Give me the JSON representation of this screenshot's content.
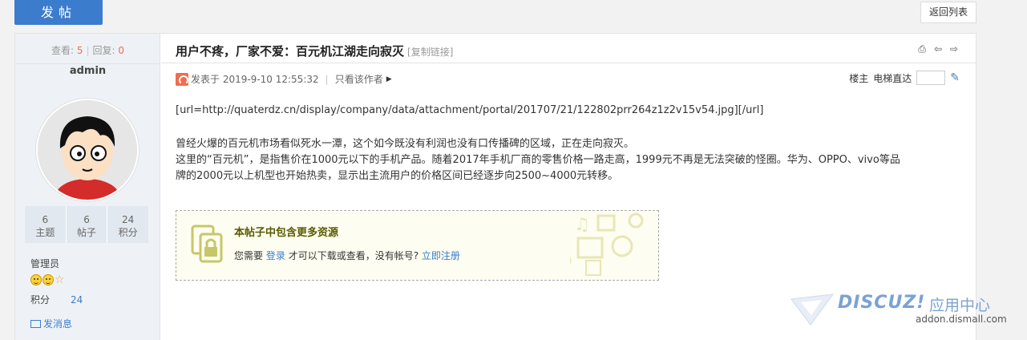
{
  "toolbar": {
    "post_label": "发帖",
    "back_label": "返回列表"
  },
  "sidebar": {
    "views_label": "查看:",
    "views": "5",
    "replies_label": "回复:",
    "replies": "0",
    "author": "admin",
    "stats": [
      {
        "value": "6",
        "label": "主题"
      },
      {
        "value": "6",
        "label": "帖子"
      },
      {
        "value": "24",
        "label": "积分"
      }
    ],
    "role": "管理员",
    "points_label": "积分",
    "points_value": "24",
    "message_label": "发消息"
  },
  "post": {
    "title": "用户不疼，厂家不爱：百元机江湖走向寂灭",
    "copy_link": "[复制链接]",
    "posted_label": "发表于 2019-9-10 12:55:32",
    "author_only": "只看该作者",
    "floor_owner": "楼主",
    "jump_label": "电梯直达",
    "body": {
      "url_line": "[url=http://quaterdz.cn/display/company/data/attachment/portal/201707/21/122802prr264z1z2v15v54.jpg][/url]",
      "p1": "曾经火爆的百元机市场看似死水一潭，这个如今既没有利润也没有口传播碑的区域，正在走向寂灭。",
      "p2": "这里的“百元机”，是指售价在1000元以下的手机产品。随着2017年手机厂商的零售价格一路走高，1999元不再是无法突破的怪圈。华为、OPPO、vivo等品",
      "p3": "牌的2000元以上机型也开始热卖，显示出主流用户的价格区间已经逐步向2500~4000元转移。"
    },
    "locked": {
      "title": "本帖子中包含更多资源",
      "desc_prefix": "您需要",
      "login": "登录",
      "desc_mid": "才可以下载或查看，没有帐号?",
      "register": "立即注册"
    }
  },
  "watermark": {
    "brand": "DISCUZ!",
    "cn": "应用中心",
    "url": "addon.dismall.com"
  },
  "colors": {
    "accent": "#3c7ccc",
    "count": "#f26c4f",
    "sidebar_bg": "#eef2f6"
  }
}
